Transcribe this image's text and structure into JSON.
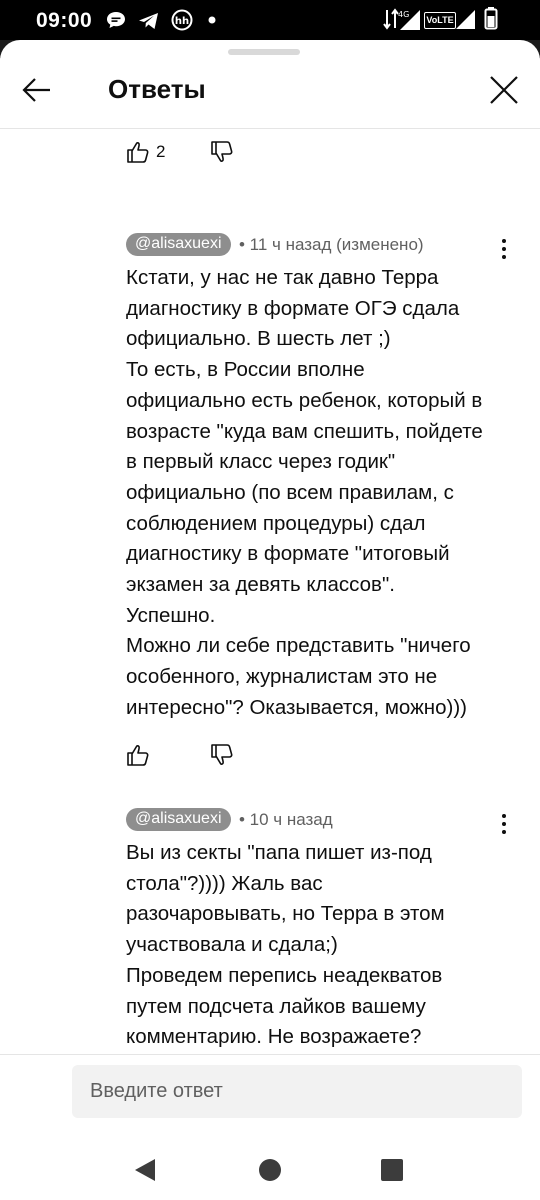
{
  "status_bar": {
    "time": "09:00",
    "icons": [
      "chat-bubble-icon",
      "telegram-icon",
      "hh-icon",
      "dot-icon",
      "data-arrows-icon",
      "signal-4g-icon",
      "volte-icon",
      "signal-icon",
      "battery-icon"
    ],
    "network": "4G",
    "volte": "VoLTE"
  },
  "header": {
    "title": "Ответы",
    "back_icon": "arrow-left-icon",
    "close_icon": "close-icon"
  },
  "top_actions": {
    "like_count": "2"
  },
  "comments": [
    {
      "author": "@alisaxuexi",
      "timestamp": "• 11 ч назад (изменено)",
      "text": "Кстати, у нас не так давно Терра\nдиагностику в формате ОГЭ сдала\nофициально. В шесть лет ;)\nТо есть, в России вполне\nофициально есть ребенок, который в\nвозрасте \"куда вам спешить, пойдете\nв первый класс через годик\"\nофициально (по всем правилам, с\nсоблюдением процедуры) сдал\nдиагностику в формате \"итоговый\nэкзамен за девять классов\".\nУспешно.\nМожно ли себе представить \"ничего\nособенного, журналистам это не\nинтересно\"? Оказывается, можно)))"
    },
    {
      "author": "@alisaxuexi",
      "timestamp": "• 10 ч назад",
      "text": "Вы из секты \"папа пишет из-под\nстола\"?)))) Жаль вас\nразочаровывать, но Терра в этом\nучаствовала и сдала;)\nПроведем перепись неадекватов\nпутем подсчета лайков вашему\nкомментарию. Не возражаете?"
    }
  ],
  "reply": {
    "placeholder": "Введите ответ"
  },
  "nav": {
    "icons": [
      "back-triangle-icon",
      "home-circle-icon",
      "recents-square-icon"
    ]
  },
  "colors": {
    "author_badge": "#8e8e8e",
    "text": "#0f0f0f",
    "secondary_text": "#606060",
    "input_bg": "#f2f2f2"
  }
}
